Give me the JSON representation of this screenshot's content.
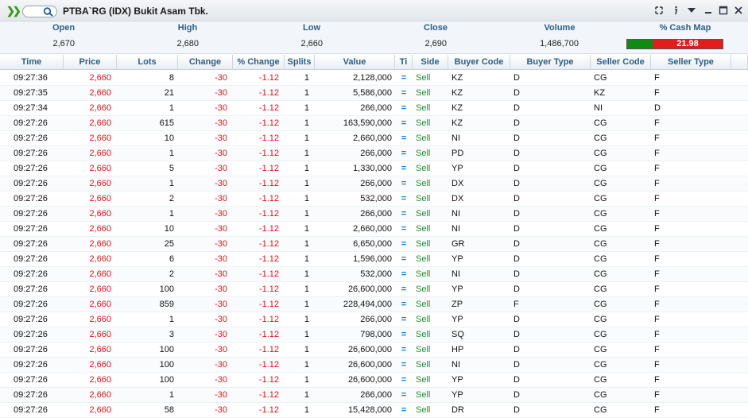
{
  "window": {
    "title": "PTBA`RG (IDX) Bukit Asam Tbk."
  },
  "icons": {
    "expand": "chevron-right-double-icon",
    "search": "search-icon",
    "link": "link-icon",
    "info": "info-icon",
    "menu": "dropdown-triangle-icon",
    "minimize": "minimize-icon",
    "maximize": "maximize-icon",
    "close": "close-icon"
  },
  "colors": {
    "down": "#d8141b",
    "up": "#17922a",
    "header_text": "#2c5e86",
    "cash_buy": "#0f8a12",
    "cash_sell": "#e01e1e"
  },
  "summary": {
    "open_label": "Open",
    "open": "2,670",
    "high_label": "High",
    "high": "2,680",
    "low_label": "Low",
    "low": "2,660",
    "close_label": "Close",
    "close": "2,690",
    "volume_label": "Volume",
    "volume": "1,486,700",
    "cashmap_label": "% Cash Map",
    "cashmap_value": "21.98"
  },
  "table": {
    "headers": [
      "Time",
      "Price",
      "Lots",
      "Change",
      "% Change",
      "Splits",
      "Value",
      "Ti",
      "Side",
      "Buyer Code",
      "Buyer Type",
      "Seller Code",
      "Seller Type"
    ],
    "rows": [
      [
        "09:27:36",
        "2,660",
        "8",
        "-30",
        "-1.12",
        "1",
        "2,128,000",
        "=",
        "Sell",
        "KZ",
        "D",
        "CG",
        "F"
      ],
      [
        "09:27:35",
        "2,660",
        "21",
        "-30",
        "-1.12",
        "1",
        "5,586,000",
        "=",
        "Sell",
        "KZ",
        "D",
        "KZ",
        "F"
      ],
      [
        "09:27:34",
        "2,660",
        "1",
        "-30",
        "-1.12",
        "1",
        "266,000",
        "=",
        "Sell",
        "KZ",
        "D",
        "NI",
        "D"
      ],
      [
        "09:27:26",
        "2,660",
        "615",
        "-30",
        "-1.12",
        "1",
        "163,590,000",
        "=",
        "Sell",
        "KZ",
        "D",
        "CG",
        "F"
      ],
      [
        "09:27:26",
        "2,660",
        "10",
        "-30",
        "-1.12",
        "1",
        "2,660,000",
        "=",
        "Sell",
        "NI",
        "D",
        "CG",
        "F"
      ],
      [
        "09:27:26",
        "2,660",
        "1",
        "-30",
        "-1.12",
        "1",
        "266,000",
        "=",
        "Sell",
        "PD",
        "D",
        "CG",
        "F"
      ],
      [
        "09:27:26",
        "2,660",
        "5",
        "-30",
        "-1.12",
        "1",
        "1,330,000",
        "=",
        "Sell",
        "YP",
        "D",
        "CG",
        "F"
      ],
      [
        "09:27:26",
        "2,660",
        "1",
        "-30",
        "-1.12",
        "1",
        "266,000",
        "=",
        "Sell",
        "DX",
        "D",
        "CG",
        "F"
      ],
      [
        "09:27:26",
        "2,660",
        "2",
        "-30",
        "-1.12",
        "1",
        "532,000",
        "=",
        "Sell",
        "DX",
        "D",
        "CG",
        "F"
      ],
      [
        "09:27:26",
        "2,660",
        "1",
        "-30",
        "-1.12",
        "1",
        "266,000",
        "=",
        "Sell",
        "NI",
        "D",
        "CG",
        "F"
      ],
      [
        "09:27:26",
        "2,660",
        "10",
        "-30",
        "-1.12",
        "1",
        "2,660,000",
        "=",
        "Sell",
        "NI",
        "D",
        "CG",
        "F"
      ],
      [
        "09:27:26",
        "2,660",
        "25",
        "-30",
        "-1.12",
        "1",
        "6,650,000",
        "=",
        "Sell",
        "GR",
        "D",
        "CG",
        "F"
      ],
      [
        "09:27:26",
        "2,660",
        "6",
        "-30",
        "-1.12",
        "1",
        "1,596,000",
        "=",
        "Sell",
        "YP",
        "D",
        "CG",
        "F"
      ],
      [
        "09:27:26",
        "2,660",
        "2",
        "-30",
        "-1.12",
        "1",
        "532,000",
        "=",
        "Sell",
        "NI",
        "D",
        "CG",
        "F"
      ],
      [
        "09:27:26",
        "2,660",
        "100",
        "-30",
        "-1.12",
        "1",
        "26,600,000",
        "=",
        "Sell",
        "YP",
        "D",
        "CG",
        "F"
      ],
      [
        "09:27:26",
        "2,660",
        "859",
        "-30",
        "-1.12",
        "1",
        "228,494,000",
        "=",
        "Sell",
        "ZP",
        "F",
        "CG",
        "F"
      ],
      [
        "09:27:26",
        "2,660",
        "1",
        "-30",
        "-1.12",
        "1",
        "266,000",
        "=",
        "Sell",
        "YP",
        "D",
        "CG",
        "F"
      ],
      [
        "09:27:26",
        "2,660",
        "3",
        "-30",
        "-1.12",
        "1",
        "798,000",
        "=",
        "Sell",
        "SQ",
        "D",
        "CG",
        "F"
      ],
      [
        "09:27:26",
        "2,660",
        "100",
        "-30",
        "-1.12",
        "1",
        "26,600,000",
        "=",
        "Sell",
        "HP",
        "D",
        "CG",
        "F"
      ],
      [
        "09:27:26",
        "2,660",
        "100",
        "-30",
        "-1.12",
        "1",
        "26,600,000",
        "=",
        "Sell",
        "NI",
        "D",
        "CG",
        "F"
      ],
      [
        "09:27:26",
        "2,660",
        "100",
        "-30",
        "-1.12",
        "1",
        "26,600,000",
        "=",
        "Sell",
        "YP",
        "D",
        "CG",
        "F"
      ],
      [
        "09:27:26",
        "2,660",
        "1",
        "-30",
        "-1.12",
        "1",
        "266,000",
        "=",
        "Sell",
        "YP",
        "D",
        "CG",
        "F"
      ],
      [
        "09:27:26",
        "2,660",
        "58",
        "-30",
        "-1.12",
        "1",
        "15,428,000",
        "=",
        "Sell",
        "DR",
        "D",
        "CG",
        "F"
      ]
    ]
  }
}
